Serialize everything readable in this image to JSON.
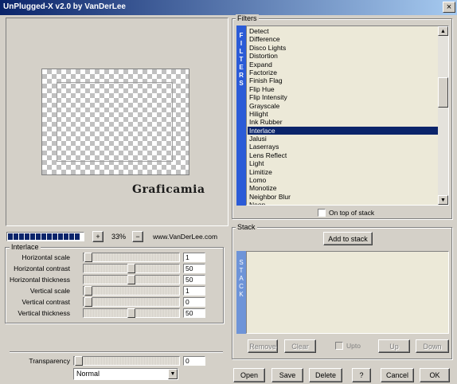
{
  "window": {
    "title": "UnPlugged-X v2.0 by VanDerLee",
    "close_glyph": "×"
  },
  "preview": {
    "watermark": "Graficamia",
    "zoom_minus": "−",
    "zoom_plus": "+",
    "zoom_value": "33%",
    "website": "www.VanDerLee.com",
    "progress_segments": 13
  },
  "filters": {
    "label": "Filters",
    "vertical_label": "FILTERS",
    "items": [
      "Detect",
      "Difference",
      "Disco Lights",
      "Distortion",
      "Expand",
      "Factorize",
      "Finish Flag",
      "Flip Hue",
      "Flip Intensity",
      "Grayscale",
      "Hilight",
      "Ink Rubber",
      "Interlace",
      "Jalusi",
      "Laserrays",
      "Lens Reflect",
      "Light",
      "Limitize",
      "Lomo",
      "Monotize",
      "Neighbor Blur",
      "Neon"
    ],
    "selected": "Interlace",
    "scroll_position": 0.32,
    "on_top_label": "On top of stack",
    "on_top_checked": false
  },
  "interlace": {
    "label": "Interlace",
    "params": [
      {
        "label": "Horizontal scale",
        "value": "1",
        "level": 0.0
      },
      {
        "label": "Horizontal contrast",
        "value": "50",
        "level": 0.5
      },
      {
        "label": "Horizontal thickness",
        "value": "50",
        "level": 0.5
      },
      {
        "label": "Vertical scale",
        "value": "1",
        "level": 0.0
      },
      {
        "label": "Vertical contrast",
        "value": "0",
        "level": 0.0
      },
      {
        "label": "Vertical thickness",
        "value": "50",
        "level": 0.5
      }
    ]
  },
  "transparency": {
    "label": "Transparency",
    "value": "0",
    "level": 0.0,
    "blend_mode": "Normal"
  },
  "stack": {
    "label": "Stack",
    "add_button": "Add to stack",
    "vertical_label": "STACK",
    "remove": "Remove",
    "clear": "Clear",
    "upto": "Upto",
    "up": "Up",
    "down": "Down"
  },
  "footer": {
    "open": "Open",
    "save": "Save",
    "delete": "Delete",
    "help": "?",
    "cancel": "Cancel",
    "ok": "OK"
  },
  "colors": {
    "selection": "#0a246a",
    "vertical_label_bg": "#2b5bd7",
    "stack_bar_bg": "#6e94d8",
    "face": "#d4d0c8"
  }
}
